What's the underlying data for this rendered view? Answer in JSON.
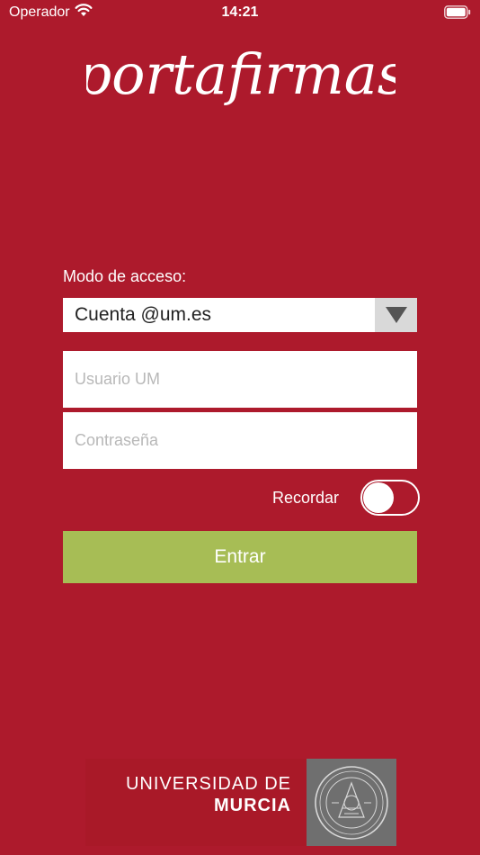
{
  "status_bar": {
    "carrier": "Operador",
    "time": "14:21"
  },
  "logo": {
    "text": "portafirmas"
  },
  "form": {
    "access_mode_label": "Modo de acceso:",
    "access_mode_value": "Cuenta @um.es",
    "user_placeholder": "Usuario UM",
    "password_placeholder": "Contraseña",
    "remember_label": "Recordar",
    "remember_on": false,
    "submit_label": "Entrar"
  },
  "university": {
    "line1": "UNIVERSIDAD DE",
    "line2": "MURCIA"
  },
  "colors": {
    "background": "#ad1a2c",
    "button": "#a7bd55",
    "seal": "#6f6f6f"
  },
  "icons": [
    "wifi-icon",
    "battery-icon",
    "dropdown-arrow-icon",
    "university-seal-icon"
  ]
}
